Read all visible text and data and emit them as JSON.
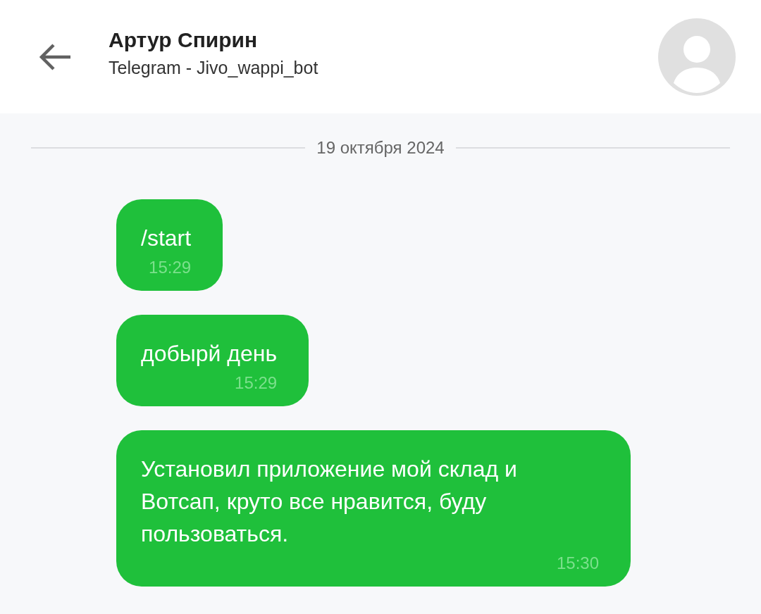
{
  "header": {
    "title": "Артур Спирин",
    "subtitle": "Telegram - Jivo_wappi_bot"
  },
  "date_divider": "19 октября 2024",
  "messages": [
    {
      "text": "/start",
      "time": "15:29"
    },
    {
      "text": "добырй день",
      "time": "15:29"
    },
    {
      "text": "Установил приложение мой склад и Вотсап, круто все нравится, буду пользоваться.",
      "time": "15:30"
    }
  ]
}
